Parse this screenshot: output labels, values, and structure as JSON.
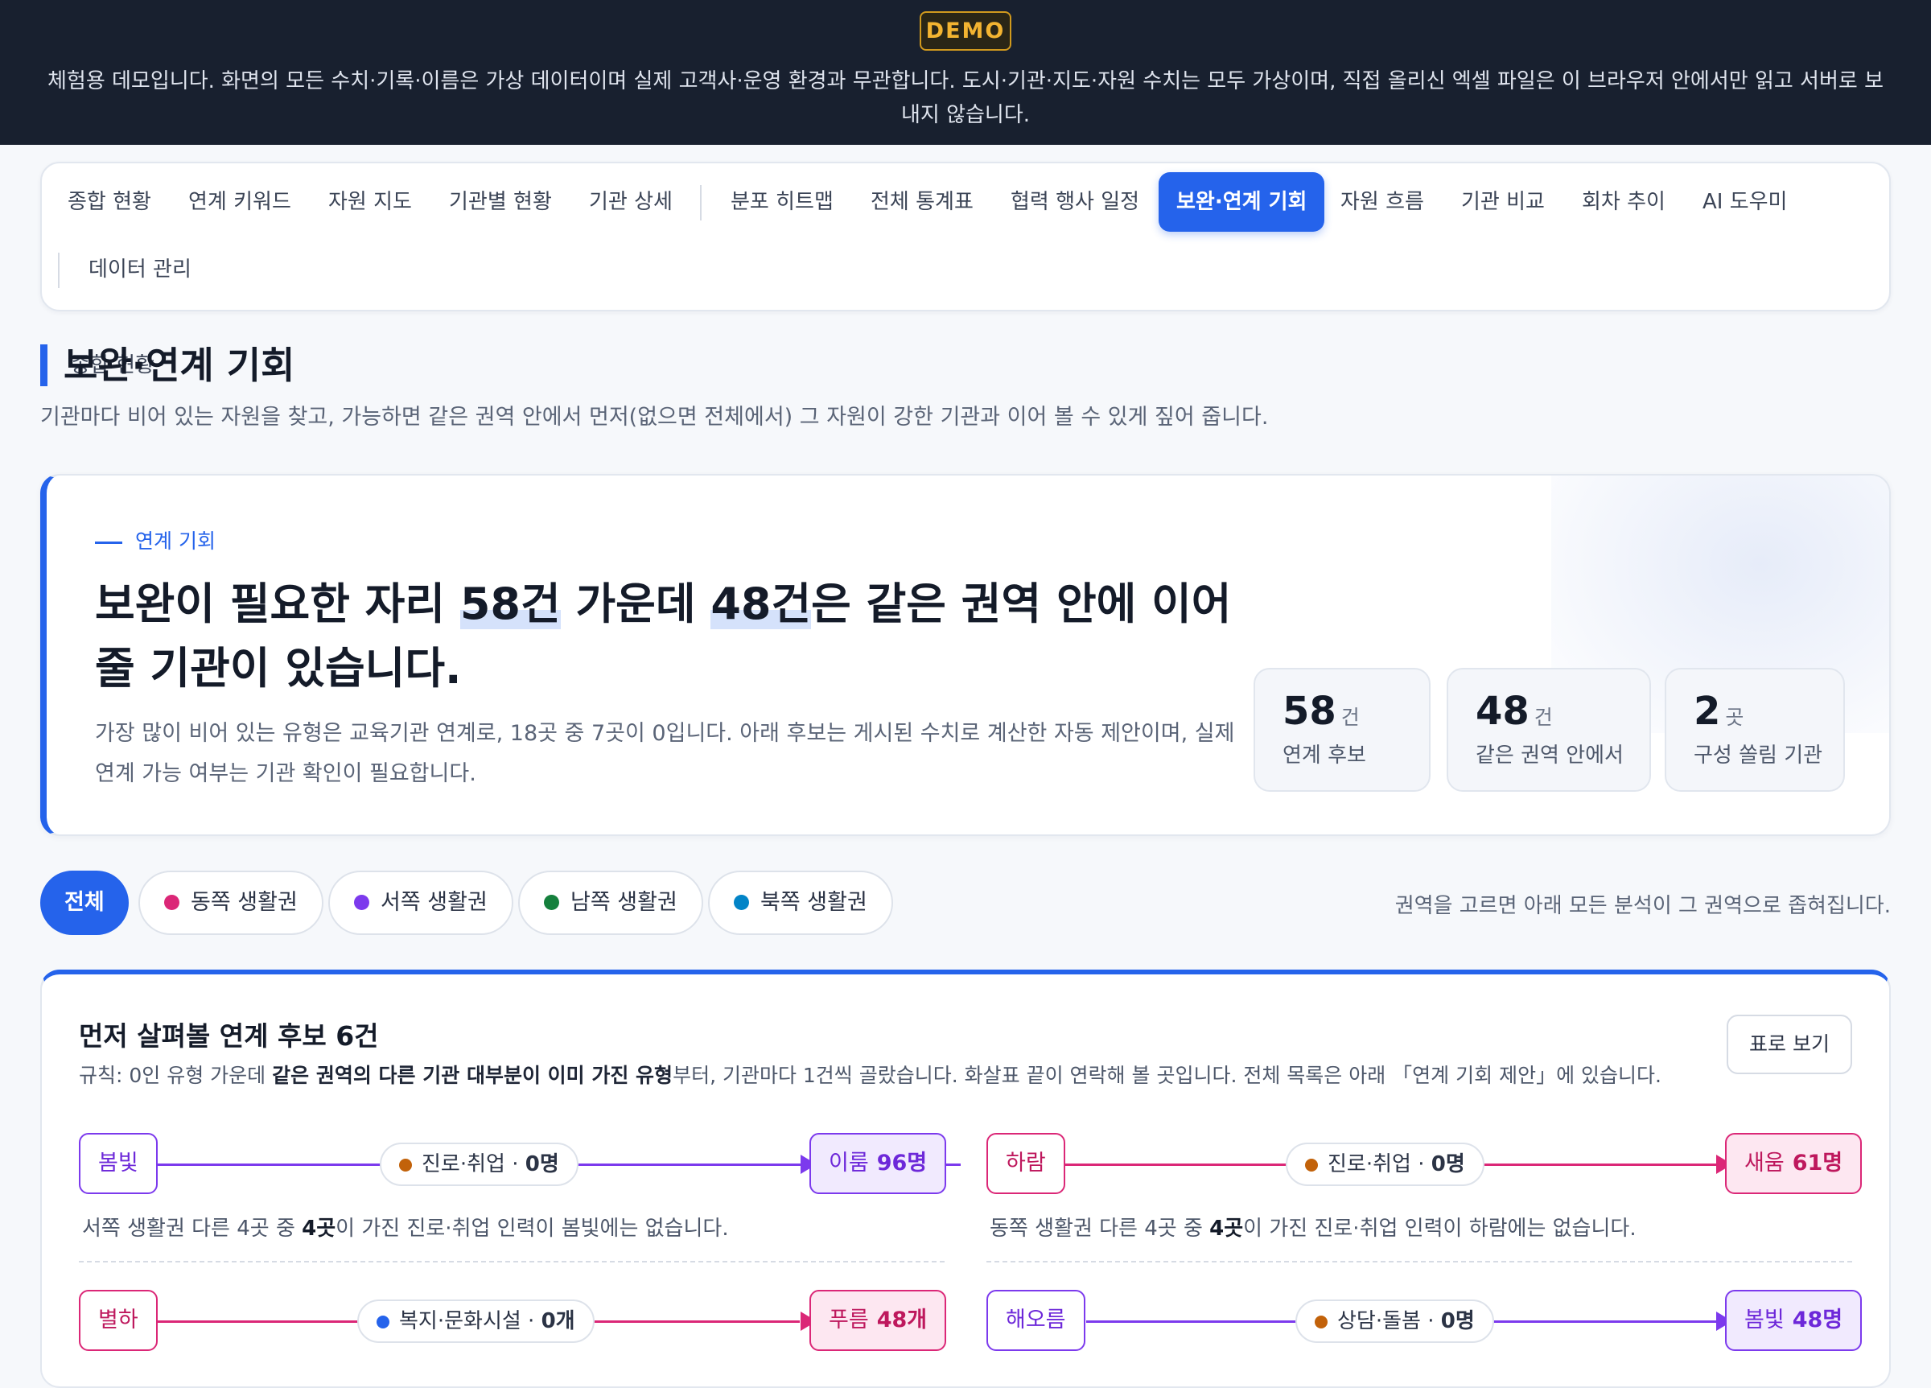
{
  "banner": {
    "badge": "DEMO",
    "text": "체험용 데모입니다. 화면의 모든 수치·기록·이름은 가상 데이터이며 실제 고객사·운영 환경과 무관합니다. 도시·기관·지도·자원 수치는 모두 가상이며, 직접 올리신 엑셀 파일은 이 브라우저 안에서만 읽고 서버로 보내지 않습니다."
  },
  "nav": {
    "items": [
      "종합 현황",
      "연계 키워드",
      "자원 지도",
      "기관별 현황",
      "기관 상세",
      "분포 히트맵",
      "전체 통계표",
      "협력 행사 일정",
      "보완·연계 기회",
      "자원 흐름",
      "기관 비교",
      "회차 추이",
      "AI 도우미",
      "데이터 관리"
    ],
    "active": "보완·연계 기회"
  },
  "page": {
    "title": "보완·연계 기회",
    "description": "기관마다 비어 있는 자원을 찾고, 가능하면 같은 권역 안에서 먼저(없으면 전체에서) 그 자원이 강한 기관과 이어 볼 수 있게 짚어 줍니다."
  },
  "hero": {
    "eyebrow": "연계 기회",
    "headline_1": "보완이 필요한 자리 ",
    "headline_num1": "58건",
    "headline_2": " 가운데 ",
    "headline_num2": "48건",
    "headline_3": "은 같은 권역 안에 이어 줄 기관이 있습니다.",
    "description": "가장 많이 비어 있는 유형은 교육기관 연계로, 18곳 중 7곳이 0입니다. 아래 후보는 게시된 수치로 계산한 자동 제안이며, 실제 연계 가능 여부는 기관 확인이 필요합니다.",
    "stats": [
      {
        "value": "58",
        "unit": "건",
        "label": "연계 후보"
      },
      {
        "value": "48",
        "unit": "건",
        "label": "같은 권역 안에서"
      },
      {
        "value": "2",
        "unit": "곳",
        "label": "구성 쏠림 기관"
      }
    ]
  },
  "filters": {
    "all": "전체",
    "regions": [
      {
        "label": "동쪽 생활권",
        "color": "#db2777"
      },
      {
        "label": "서쪽 생활권",
        "color": "#7c3aed"
      },
      {
        "label": "남쪽 생활권",
        "color": "#15803d"
      },
      {
        "label": "북쪽 생활권",
        "color": "#0284c7"
      }
    ],
    "hint": "권역을 고르면 아래 모든 분석이 그 권역으로 좁혀집니다."
  },
  "candidates": {
    "title": "먼저 살펴볼 연계 후보 6건",
    "rule_prefix": "규칙: 0인 유형 가운데 ",
    "rule_bold": "같은 권역의 다른 기관 대부분이 이미 가진 유형",
    "rule_suffix": "부터, 기관마다 1건씩 골랐습니다. 화살표 끝이 연락해 볼 곳입니다. 전체 목록은 아래 「연계 기회 제안」에 있습니다.",
    "table_button": "표로 보기",
    "items": [
      {
        "from": "봄빛",
        "type": "진로·취업",
        "type_value": "0명",
        "type_color": "#c2620a",
        "to_name": "이룸",
        "to_value": "96명",
        "color": "#7c3aed",
        "to_bg": "#f1eafe",
        "note_prefix": "서쪽 생활권 다른 4곳 중 ",
        "note_bold": "4곳",
        "note_suffix": "이 가진 진로·취업 인력이 봄빛에는 없습니다."
      },
      {
        "from": "하람",
        "type": "진로·취업",
        "type_value": "0명",
        "type_color": "#c2620a",
        "to_name": "새움",
        "to_value": "61명",
        "color": "#db2777",
        "to_bg": "#fde7f1",
        "note_prefix": "동쪽 생활권 다른 4곳 중 ",
        "note_bold": "4곳",
        "note_suffix": "이 가진 진로·취업 인력이 하람에는 없습니다."
      },
      {
        "from": "별하",
        "type": "복지·문화시설",
        "type_value": "0개",
        "type_color": "#2563eb",
        "to_name": "푸름",
        "to_value": "48개",
        "color": "#db2777",
        "to_bg": "#fde7f1"
      },
      {
        "from": "해오름",
        "type": "상담·돌봄",
        "type_value": "0명",
        "type_color": "#c2620a",
        "to_name": "봄빛",
        "to_value": "48명",
        "color": "#7c3aed",
        "to_bg": "#f1eafe"
      }
    ]
  }
}
